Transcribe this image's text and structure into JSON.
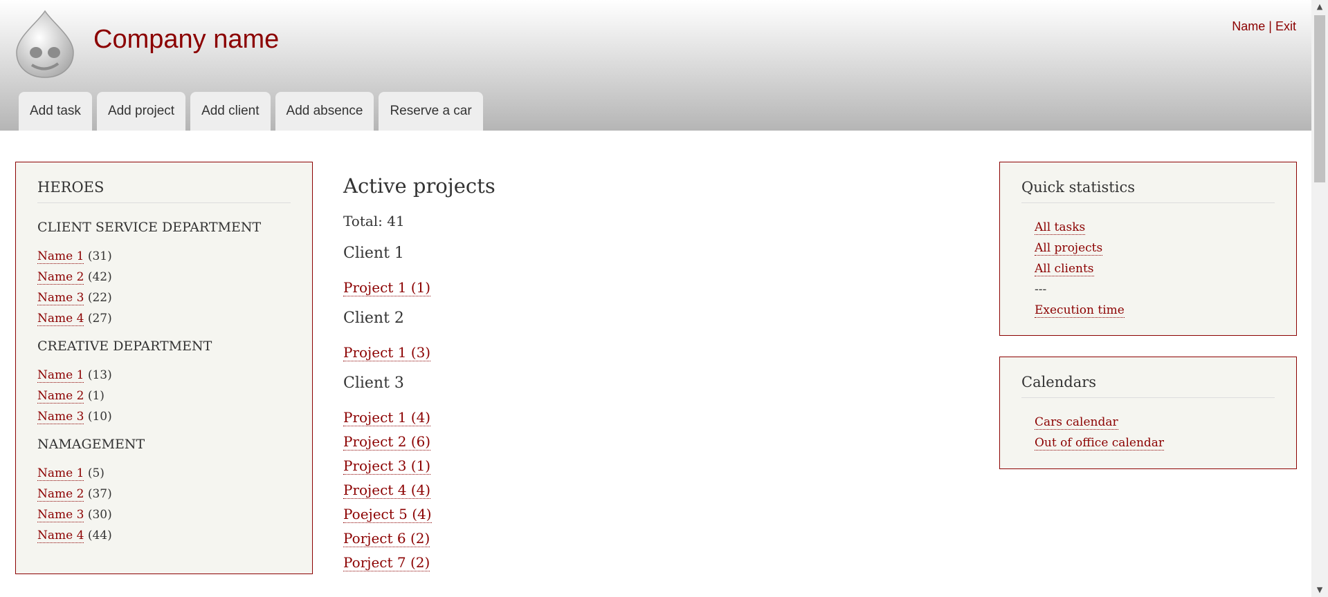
{
  "header": {
    "site_name": "Company name",
    "user_name": "Name",
    "separator": " | ",
    "exit_label": "Exit",
    "tabs": [
      {
        "label": "Add task"
      },
      {
        "label": "Add project"
      },
      {
        "label": "Add client"
      },
      {
        "label": "Add absence"
      },
      {
        "label": "Reserve a car"
      }
    ]
  },
  "sidebar": {
    "title": "HEROES",
    "departments": [
      {
        "name": "CLIENT SERVICE DEPARTMENT",
        "members": [
          {
            "name": "Name 1",
            "count": " (31)"
          },
          {
            "name": "Name 2",
            "count": " (42)"
          },
          {
            "name": "Name 3",
            "count": " (22)"
          },
          {
            "name": "Name 4",
            "count": " (27)"
          }
        ]
      },
      {
        "name": "CREATIVE DEPARTMENT",
        "members": [
          {
            "name": "Name 1",
            "count": " (13)"
          },
          {
            "name": "Name 2",
            "count": " (1)"
          },
          {
            "name": "Name 3",
            "count": " (10)"
          }
        ]
      },
      {
        "name": "NAMAGEMENT",
        "members": [
          {
            "name": "Name 1",
            "count": " (5)"
          },
          {
            "name": "Name 2",
            "count": " (37)"
          },
          {
            "name": "Name 3",
            "count": " (30)"
          },
          {
            "name": "Name 4",
            "count": " (44)"
          }
        ]
      }
    ]
  },
  "main": {
    "title": "Active projects",
    "total": "Total: 41",
    "clients": [
      {
        "name": "Client 1",
        "projects": [
          "Project 1 (1)"
        ]
      },
      {
        "name": "Client 2",
        "projects": [
          "Project 1 (3)"
        ]
      },
      {
        "name": "Client 3",
        "projects": [
          "Project 1 (4)",
          "Project 2 (6)",
          "Project 3 (1)",
          "Project 4 (4)",
          "Poeject 5 (4)",
          "Porject 6 (2)",
          "Porject 7 (2)"
        ]
      }
    ]
  },
  "stats": {
    "title": "Quick statistics",
    "items": [
      {
        "label": "All tasks",
        "link": true
      },
      {
        "label": "All projects",
        "link": true
      },
      {
        "label": "All clients",
        "link": true
      },
      {
        "label": "---",
        "link": false
      },
      {
        "label": "Execution time",
        "link": true
      }
    ]
  },
  "calendars": {
    "title": "Calendars",
    "items": [
      {
        "label": "Cars calendar"
      },
      {
        "label": "Out of office calendar"
      }
    ]
  },
  "colors": {
    "accent": "#8b0000",
    "box_bg": "#f5f5f0"
  },
  "icons": {
    "logo": "drupal-drop-logo",
    "scroll_up": "arrow-up-icon",
    "scroll_down": "arrow-down-icon"
  }
}
